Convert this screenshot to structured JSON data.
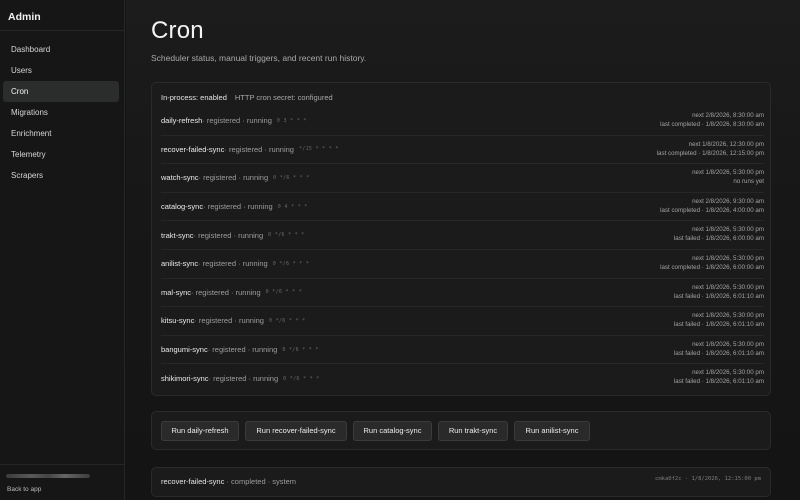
{
  "app": {
    "title": "Admin"
  },
  "sidebar": {
    "items": [
      {
        "label": "Dashboard",
        "active": false
      },
      {
        "label": "Users",
        "active": false
      },
      {
        "label": "Cron",
        "active": true
      },
      {
        "label": "Migrations",
        "active": false
      },
      {
        "label": "Enrichment",
        "active": false
      },
      {
        "label": "Telemetry",
        "active": false
      },
      {
        "label": "Scrapers",
        "active": false
      }
    ],
    "back_label": "Back to app"
  },
  "page": {
    "title": "Cron",
    "subtitle": "Scheduler status, manual triggers, and recent run history."
  },
  "status": {
    "in_process": "In-process: enabled",
    "secret": "HTTP cron secret: configured"
  },
  "jobs": [
    {
      "name": "daily-refresh",
      "meta": " · registered · running",
      "schedule": "0 3 * * *",
      "next": "next 2/8/2026, 8:30:00 am",
      "last": "last completed · 1/8/2026, 8:30:00 am"
    },
    {
      "name": "recover-failed-sync",
      "meta": " · registered · running",
      "schedule": "*/15 * * * *",
      "next": "next 1/8/2026, 12:30:00 pm",
      "last": "last completed · 1/8/2026, 12:15:00 pm"
    },
    {
      "name": "watch-sync",
      "meta": " · registered · running",
      "schedule": "0 */6 * * *",
      "next": "next 1/8/2026, 5:30:00 pm",
      "last": "no runs yet"
    },
    {
      "name": "catalog-sync",
      "meta": " · registered · running",
      "schedule": "0 4 * * *",
      "next": "next 2/8/2026, 9:30:00 am",
      "last": "last completed · 1/8/2026, 4:00:00 am"
    },
    {
      "name": "trakt-sync",
      "meta": " · registered · running",
      "schedule": "0 */6 * * *",
      "next": "next 1/8/2026, 5:30:00 pm",
      "last": "last failed · 1/8/2026, 6:00:00 am"
    },
    {
      "name": "anilist-sync",
      "meta": " · registered · running",
      "schedule": "0 */6 * * *",
      "next": "next 1/8/2026, 5:30:00 pm",
      "last": "last completed · 1/8/2026, 6:00:00 am"
    },
    {
      "name": "mal-sync",
      "meta": " · registered · running",
      "schedule": "0 */6 * * *",
      "next": "next 1/8/2026, 5:30:00 pm",
      "last": "last failed · 1/8/2026, 6:01:10 am"
    },
    {
      "name": "kitsu-sync",
      "meta": " · registered · running",
      "schedule": "0 */6 * * *",
      "next": "next 1/8/2026, 5:30:00 pm",
      "last": "last failed · 1/8/2026, 6:01:10 am"
    },
    {
      "name": "bangumi-sync",
      "meta": " · registered · running",
      "schedule": "0 */6 * * *",
      "next": "next 1/8/2026, 5:30:00 pm",
      "last": "last failed · 1/8/2026, 6:01:10 am"
    },
    {
      "name": "shikimori-sync",
      "meta": " · registered · running",
      "schedule": "0 */6 * * *",
      "next": "next 1/8/2026, 5:30:00 pm",
      "last": "last failed · 1/8/2026, 6:01:10 am"
    }
  ],
  "actions": [
    {
      "label": "Run daily-refresh"
    },
    {
      "label": "Run recover-failed-sync"
    },
    {
      "label": "Run catalog-sync"
    },
    {
      "label": "Run trakt-sync"
    },
    {
      "label": "Run anilist-sync"
    }
  ],
  "runs": [
    {
      "name": "recover-failed-sync",
      "meta": " · completed · system",
      "right": "cmka0f2c · 1/8/2026, 12:15:00 pm"
    }
  ]
}
